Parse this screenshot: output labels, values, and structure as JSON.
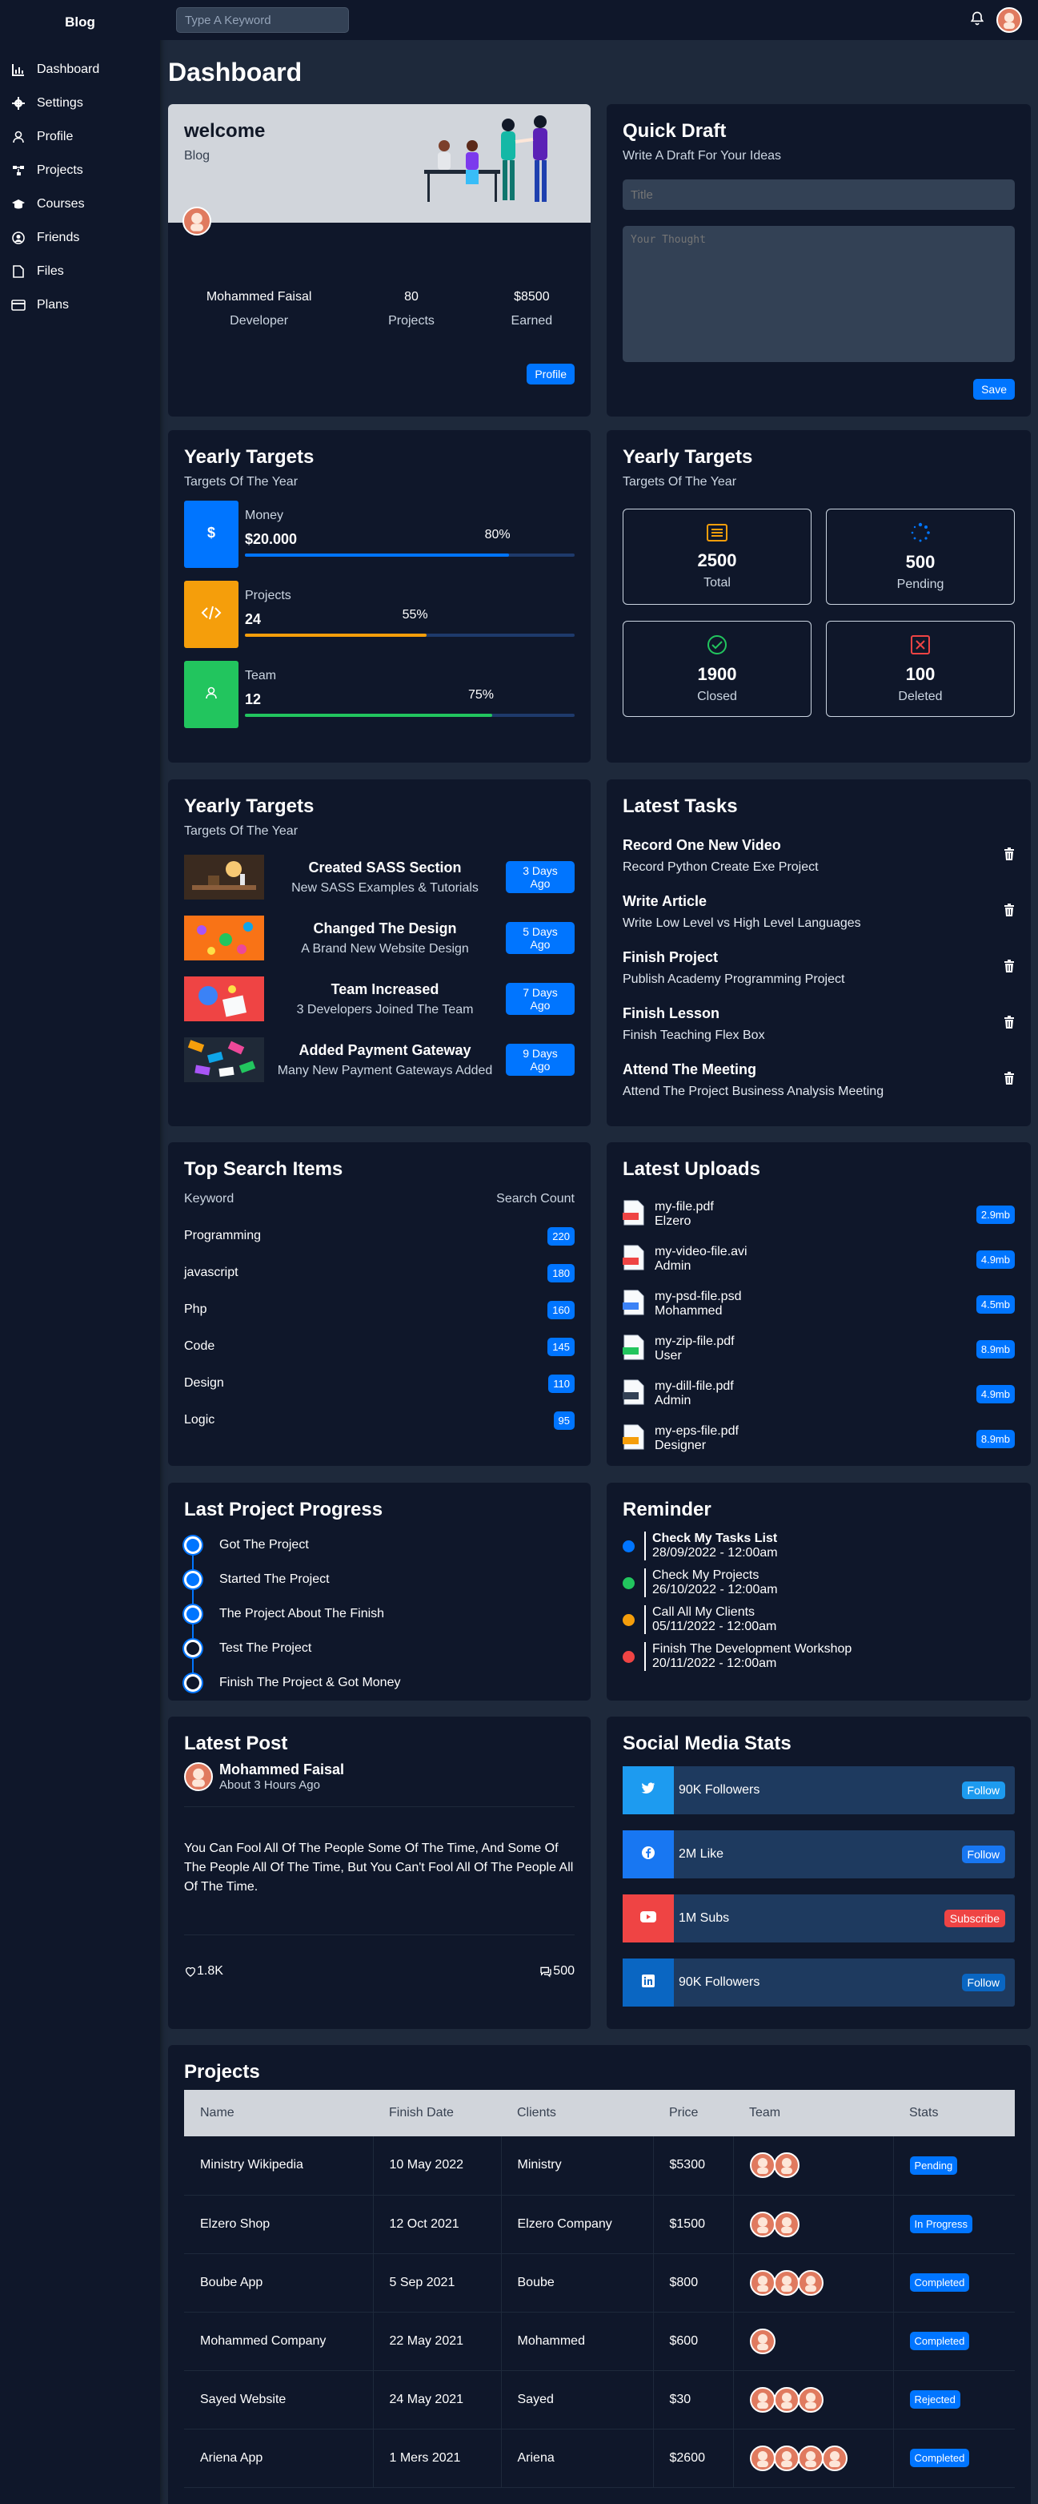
{
  "sidebar": {
    "brand": "Blog",
    "items": [
      {
        "label": "Dashboard",
        "icon": "chart-icon"
      },
      {
        "label": "Settings",
        "icon": "gear-icon"
      },
      {
        "label": "Profile",
        "icon": "user-icon"
      },
      {
        "label": "Projects",
        "icon": "sitemap-icon"
      },
      {
        "label": "Courses",
        "icon": "graduation-cap-icon"
      },
      {
        "label": "Friends",
        "icon": "user-circle-icon"
      },
      {
        "label": "Files",
        "icon": "file-icon"
      },
      {
        "label": "Plans",
        "icon": "credit-card-icon"
      }
    ]
  },
  "topbar": {
    "search_placeholder": "Type A Keyword"
  },
  "page_title": "Dashboard",
  "welcome": {
    "title": "welcome",
    "subtitle": "Blog",
    "stats": [
      {
        "value": "Mohammed Faisal",
        "label": "Developer"
      },
      {
        "value": "80",
        "label": "Projects"
      },
      {
        "value": "$8500",
        "label": "Earned"
      }
    ],
    "button": "Profile"
  },
  "quick_draft": {
    "title": "Quick Draft",
    "subtitle": "Write A Draft For Your Ideas",
    "title_placeholder": "Title",
    "body_placeholder": "Your Thought",
    "button": "Save"
  },
  "targets": {
    "title": "Yearly Targets",
    "subtitle": "Targets Of The Year",
    "items": [
      {
        "name": "Money",
        "value": "$20.000",
        "percent": "80%",
        "fraction": 0.8,
        "color": "#0075ff",
        "icon": "dollar-icon"
      },
      {
        "name": "Projects",
        "value": "24",
        "percent": "55%",
        "fraction": 0.55,
        "color": "#f59e0b",
        "icon": "code-icon"
      },
      {
        "name": "Team",
        "value": "12",
        "percent": "75%",
        "fraction": 0.75,
        "color": "#22c55e",
        "icon": "user-icon"
      }
    ]
  },
  "targets_stats": {
    "title": "Yearly Targets",
    "subtitle": "Targets Of The Year",
    "items": [
      {
        "value": "2500",
        "label": "Total",
        "color": "#f59e0b",
        "icon": "list-icon"
      },
      {
        "value": "500",
        "label": "Pending",
        "color": "#0075ff",
        "icon": "spinner-icon"
      },
      {
        "value": "1900",
        "label": "Closed",
        "color": "#22c55e",
        "icon": "check-circle-icon"
      },
      {
        "value": "100",
        "label": "Deleted",
        "color": "#ef4444",
        "icon": "x-square-icon"
      }
    ]
  },
  "news": {
    "title": "Yearly Targets",
    "subtitle": "Targets Of The Year",
    "items": [
      {
        "title": "Created SASS Section",
        "desc": "New SASS Examples & Tutorials",
        "badge": "3 Days Ago"
      },
      {
        "title": "Changed The Design",
        "desc": "A Brand New Website Design",
        "badge": "5 Days Ago"
      },
      {
        "title": "Team Increased",
        "desc": "3 Developers Joined The Team",
        "badge": "7 Days Ago"
      },
      {
        "title": "Added Payment Gateway",
        "desc": "Many New Payment Gateways Added",
        "badge": "9 Days Ago"
      }
    ]
  },
  "tasks": {
    "title": "Latest Tasks",
    "items": [
      {
        "title": "Record One New Video",
        "desc": "Record Python Create Exe Project"
      },
      {
        "title": "Write Article",
        "desc": "Write Low Level vs High Level Languages"
      },
      {
        "title": "Finish Project",
        "desc": "Publish Academy Programming Project"
      },
      {
        "title": "Finish Lesson",
        "desc": "Finish Teaching Flex Box"
      },
      {
        "title": "Attend The Meeting",
        "desc": "Attend The Project Business Analysis Meeting"
      }
    ]
  },
  "search_items": {
    "title": "Top Search Items",
    "col_keyword": "Keyword",
    "col_count": "Search Count",
    "items": [
      {
        "keyword": "Programming",
        "count": "220"
      },
      {
        "keyword": "javascript",
        "count": "180"
      },
      {
        "keyword": "Php",
        "count": "160"
      },
      {
        "keyword": "Code",
        "count": "145"
      },
      {
        "keyword": "Design",
        "count": "110"
      },
      {
        "keyword": "Logic",
        "count": "95"
      }
    ]
  },
  "uploads": {
    "title": "Latest Uploads",
    "items": [
      {
        "name": "my-file.pdf",
        "owner": "Elzero",
        "size": "2.9mb",
        "type": "PDF",
        "color": "#ef4444"
      },
      {
        "name": "my-video-file.avi",
        "owner": "Admin",
        "size": "4.9mb",
        "type": "AVI",
        "color": "#ef4444"
      },
      {
        "name": "my-psd-file.psd",
        "owner": "Mohammed",
        "size": "4.5mb",
        "type": "PSD",
        "color": "#3b82f6"
      },
      {
        "name": "my-zip-file.pdf",
        "owner": "User",
        "size": "8.9mb",
        "type": "ZIP",
        "color": "#22c55e"
      },
      {
        "name": "my-dill-file.pdf",
        "owner": "Admin",
        "size": "4.9mb",
        "type": "DLL",
        "color": "#334155"
      },
      {
        "name": "my-eps-file.pdf",
        "owner": "Designer",
        "size": "8.9mb",
        "type": "EPS",
        "color": "#f59e0b"
      }
    ]
  },
  "progress": {
    "title": "Last Project Progress",
    "items": [
      {
        "label": "Got The Project",
        "done": true
      },
      {
        "label": "Started The Project",
        "done": true
      },
      {
        "label": "The Project About The Finish",
        "done": true
      },
      {
        "label": "Test The Project",
        "done": false
      },
      {
        "label": "Finish The Project & Got Money",
        "done": false
      }
    ]
  },
  "reminder": {
    "title": "Reminder",
    "items": [
      {
        "title": "Check My Tasks List",
        "date": "28/09/2022 - 12:00am",
        "color": "#0075ff"
      },
      {
        "title": "Check My Projects",
        "date": "26/10/2022 - 12:00am",
        "color": "#22c55e"
      },
      {
        "title": "Call All My Clients",
        "date": "05/11/2022 - 12:00am",
        "color": "#f59e0b"
      },
      {
        "title": "Finish The Development Workshop",
        "date": "20/11/2022 - 12:00am",
        "color": "#ef4444"
      }
    ]
  },
  "latest_post": {
    "title": "Latest Post",
    "author": "Mohammed Faisal",
    "time": "About 3 Hours Ago",
    "body": "You Can Fool All Of The People Some Of The Time, And Some Of The People All Of The Time, But You Can't Fool All Of The People All Of The Time.",
    "likes": "1.8K",
    "comments": "500"
  },
  "social": {
    "title": "Social Media Stats",
    "items": [
      {
        "label": "90K Followers",
        "button": "Follow",
        "icon": "twitter-icon",
        "color": "#1d9bf0"
      },
      {
        "label": "2M Like",
        "button": "Follow",
        "icon": "facebook-icon",
        "color": "#1877f2"
      },
      {
        "label": "1M Subs",
        "button": "Subscribe",
        "icon": "youtube-icon",
        "color": "#ef4444"
      },
      {
        "label": "90K Followers",
        "button": "Follow",
        "icon": "linkedin-icon",
        "color": "#0a66c2"
      }
    ]
  },
  "projects": {
    "title": "Projects",
    "headers": [
      "Name",
      "Finish Date",
      "Clients",
      "Price",
      "Team",
      "Stats"
    ],
    "rows": [
      {
        "name": "Ministry Wikipedia",
        "date": "10 May 2022",
        "client": "Ministry",
        "price": "$5300",
        "team": 2,
        "status": "Pending"
      },
      {
        "name": "Elzero Shop",
        "date": "12 Oct 2021",
        "client": "Elzero Company",
        "price": "$1500",
        "team": 2,
        "status": "In Progress"
      },
      {
        "name": "Boube App",
        "date": "5 Sep 2021",
        "client": "Boube",
        "price": "$800",
        "team": 3,
        "status": "Completed"
      },
      {
        "name": "Mohammed Company",
        "date": "22 May 2021",
        "client": "Mohammed",
        "price": "$600",
        "team": 1,
        "status": "Completed"
      },
      {
        "name": "Sayed Website",
        "date": "24 May 2021",
        "client": "Sayed",
        "price": "$30",
        "team": 3,
        "status": "Rejected"
      },
      {
        "name": "Ariena App",
        "date": "1 Mers 2021",
        "client": "Ariena",
        "price": "$2600",
        "team": 4,
        "status": "Completed"
      }
    ]
  }
}
